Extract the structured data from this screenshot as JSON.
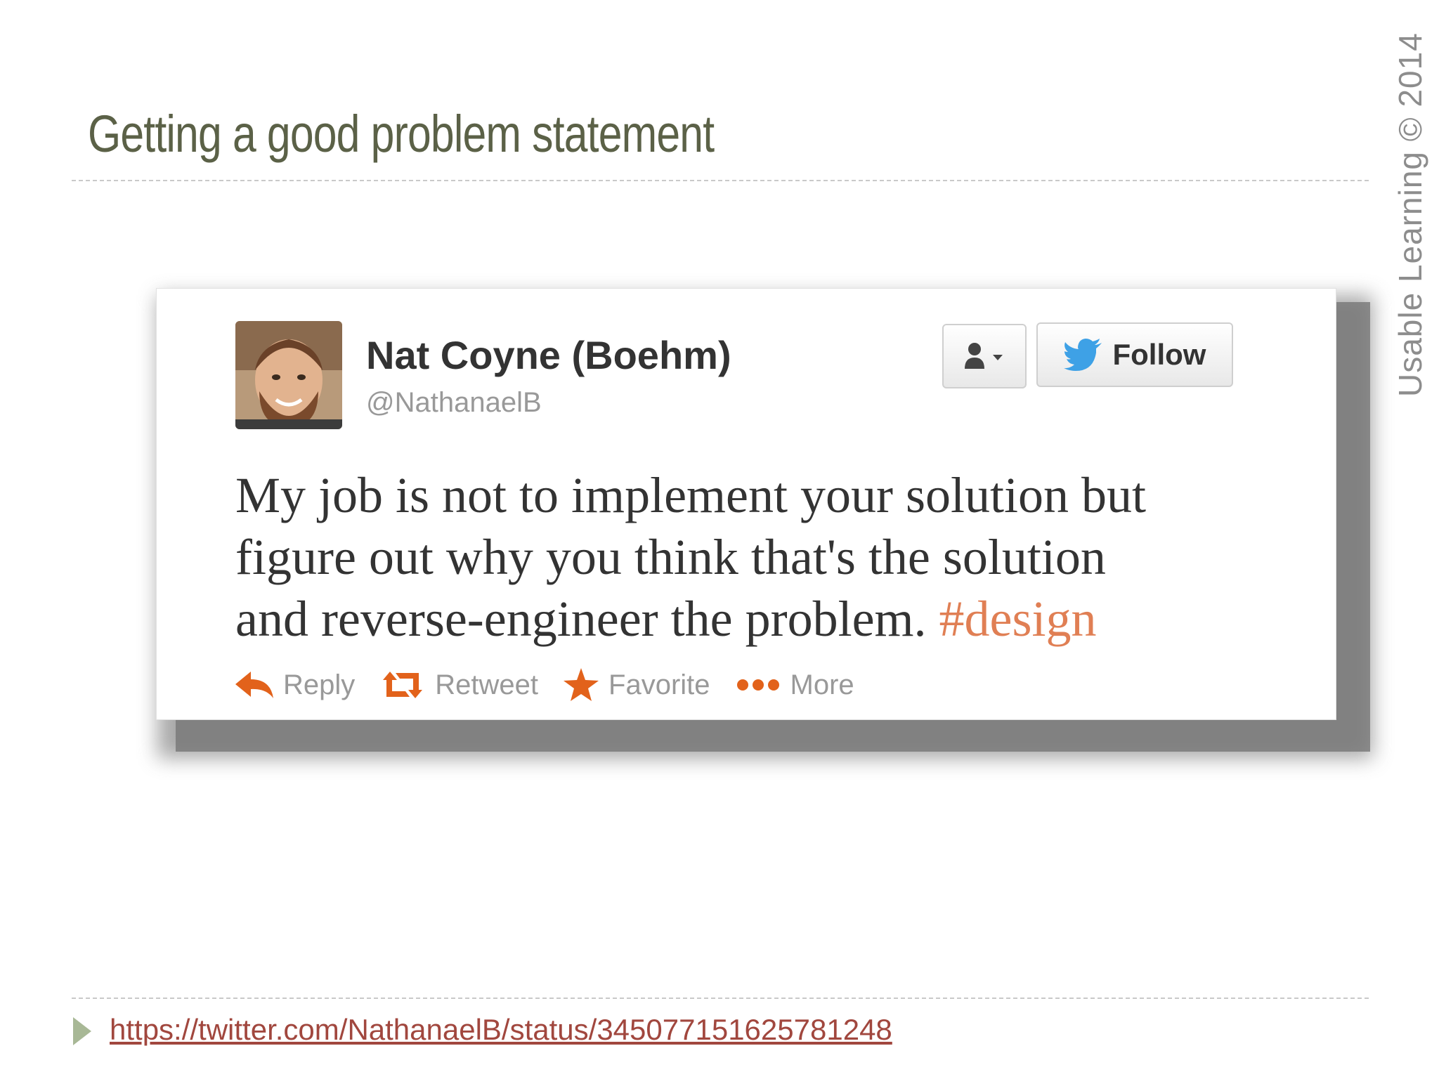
{
  "slide": {
    "title": "Getting a good problem statement",
    "copyright": "Usable Learning © 2014",
    "source_link": "https://twitter.com/NathanaelB/status/345077151625781248"
  },
  "tweet": {
    "user_name": "Nat Coyne (Boehm)",
    "handle": "@NathanaelB",
    "follow_label": "Follow",
    "text_line1": "My job is not to implement your solution but",
    "text_line2": "figure out why you think that's the solution",
    "text_line3": "and reverse-engineer the problem.",
    "hashtag": "#design",
    "actions": [
      {
        "label": "Reply",
        "icon": "reply-icon"
      },
      {
        "label": "Retweet",
        "icon": "retweet-icon"
      },
      {
        "label": "Favorite",
        "icon": "star-icon"
      },
      {
        "label": "More",
        "icon": "more-dots-icon"
      }
    ]
  },
  "colors": {
    "title": "#5b6147",
    "twitter_blue": "#1da1f2",
    "action_orange": "#e2621b",
    "hashtag": "#e07f54",
    "link": "#a1473e"
  }
}
